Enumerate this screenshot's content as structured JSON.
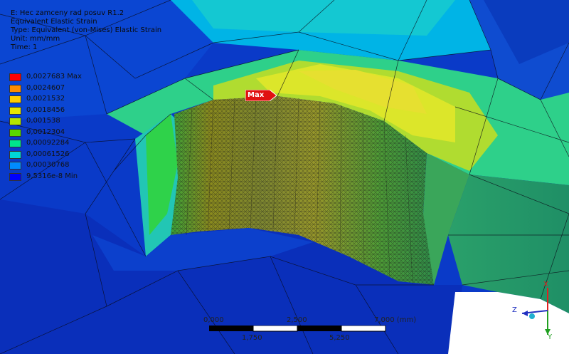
{
  "header": {
    "title": "E: Hec zamceny rad posuv R1.2",
    "result": "Equivalent Elastic Strain",
    "type": "Type: Equivalent (von-Mises) Elastic Strain",
    "unit": "Unit: mm/mm",
    "time": "Time: 1"
  },
  "legend": [
    {
      "label": "0,0027683 Max",
      "color": "#ff0000"
    },
    {
      "label": "0,0024607",
      "color": "#ff8c00"
    },
    {
      "label": "0,0021532",
      "color": "#ffcc00"
    },
    {
      "label": "0,0018456",
      "color": "#e6e600"
    },
    {
      "label": "0,001538",
      "color": "#b4e600"
    },
    {
      "label": "0,0012304",
      "color": "#5ad700"
    },
    {
      "label": "0,00092284",
      "color": "#00e68c"
    },
    {
      "label": "0,00061526",
      "color": "#00d7d7"
    },
    {
      "label": "0,00030768",
      "color": "#008cff"
    },
    {
      "label": "9,5316e-8 Min",
      "color": "#0000ff"
    }
  ],
  "max_label": "Max",
  "scale": {
    "top_ticks": [
      "0,000",
      "2,500",
      "7,000 (mm)"
    ],
    "bottom_ticks": [
      "1,750",
      "5,250"
    ]
  },
  "triad": {
    "x": "X",
    "y": "Y",
    "z": "Z"
  }
}
